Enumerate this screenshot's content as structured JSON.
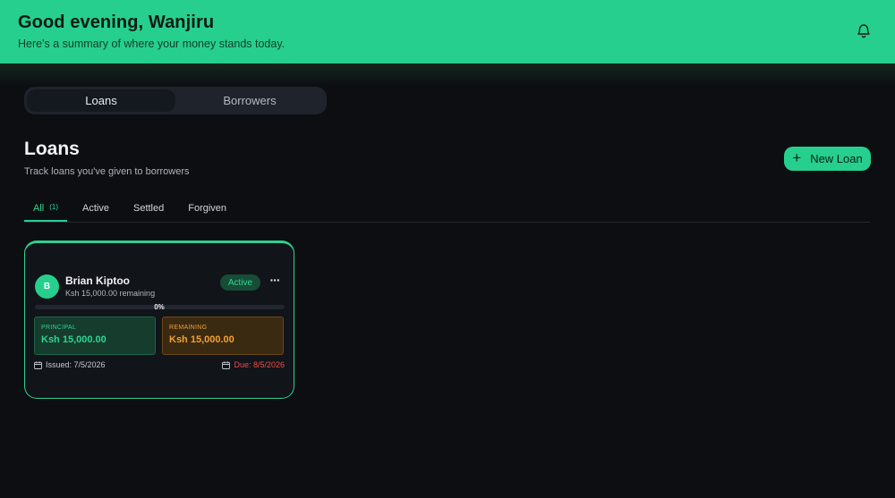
{
  "header": {
    "greeting": "Good evening, Wanjiru",
    "subtitle": "Here's a summary of where your money stands today."
  },
  "switcher": {
    "items": [
      {
        "label": "Loans",
        "active": true
      },
      {
        "label": "Borrowers",
        "active": false
      }
    ]
  },
  "section": {
    "title": "Loans",
    "subtitle": "Track loans you've given to borrowers",
    "new_button": "New Loan"
  },
  "tabs": [
    {
      "label": "All",
      "count": "(1)",
      "active": true
    },
    {
      "label": "Active"
    },
    {
      "label": "Settled"
    },
    {
      "label": "Forgiven"
    }
  ],
  "loan": {
    "initial": "B",
    "name": "Brian Kiptoo",
    "remaining_text": "Ksh 15,000.00 remaining",
    "status": "Active",
    "progress_label": "0%",
    "progress_fraction": 0,
    "principal_label": "PRINCIPAL",
    "principal_value": "Ksh 15,000.00",
    "remaining_label": "REMAINING",
    "remaining_value": "Ksh 15,000.00",
    "issued": "Issued: 7/5/2026",
    "due": "Due: 8/5/2026"
  },
  "colors": {
    "brand": "#26cf8e",
    "remaining": "#f0a233",
    "due": "#ef4a4a"
  }
}
